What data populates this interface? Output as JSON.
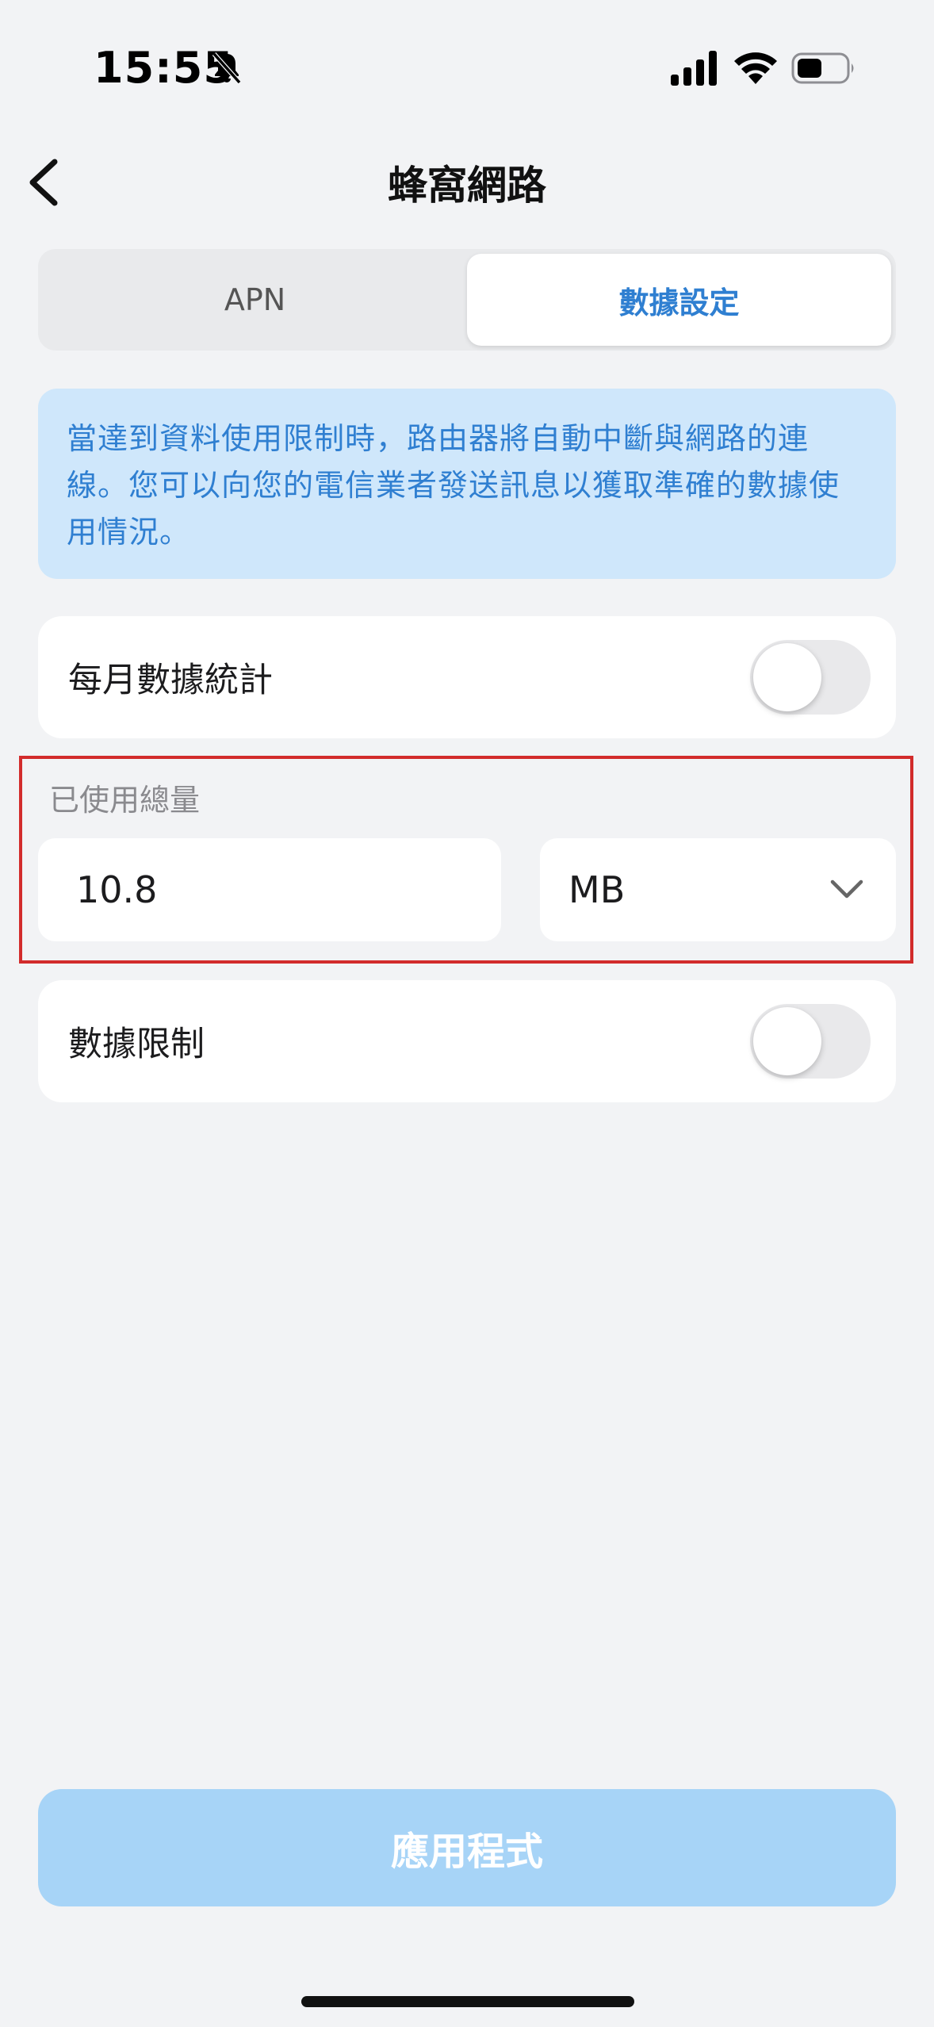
{
  "status_bar": {
    "time": "15:55"
  },
  "nav": {
    "title": "蜂窩網路"
  },
  "tabs": [
    {
      "label": "APN",
      "active": false
    },
    {
      "label": "數據設定",
      "active": true
    }
  ],
  "info_banner": {
    "text": "當達到資料使用限制時，路由器將自動中斷與網路的連線。您可以向您的電信業者發送訊息以獲取準確的數據使用情況。"
  },
  "monthly_stats": {
    "label": "每月數據統計",
    "enabled": false
  },
  "used_total": {
    "caption": "已使用總量",
    "value": "10.8",
    "unit": "MB"
  },
  "data_limit": {
    "label": "數據限制",
    "enabled": false
  },
  "apply_button": {
    "label": "應用程式"
  },
  "colors": {
    "accent": "#2f7fd1",
    "banner_bg": "#cfe7fb",
    "button_disabled": "#a7d4f7",
    "highlight": "#d22b2b"
  }
}
